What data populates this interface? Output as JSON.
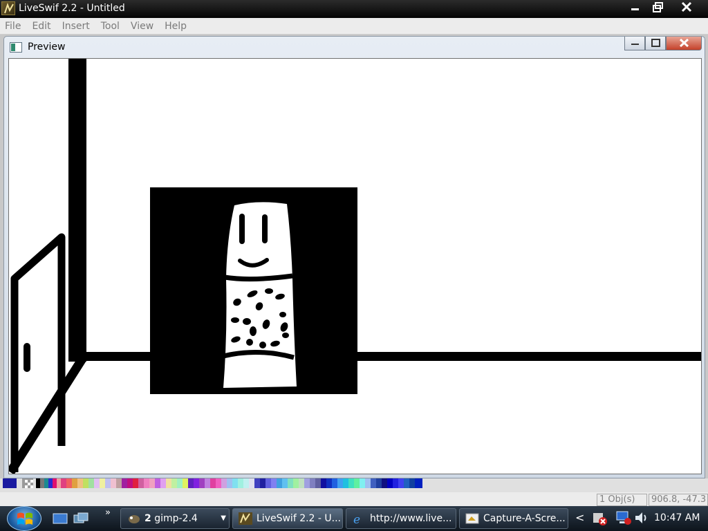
{
  "window": {
    "title": "LiveSwif 2.2 - Untitled"
  },
  "menu": {
    "items": [
      "File",
      "Edit",
      "Insert",
      "Tool",
      "View",
      "Help"
    ]
  },
  "preview": {
    "title": "Preview"
  },
  "status": {
    "objects": "1 Obj(s)",
    "coords": "906.8, -47.3"
  },
  "taskbar": {
    "overflow_glyph": "»",
    "buttons": [
      {
        "label": "2",
        "label2": "gimp-2.4",
        "arrow": "▼"
      },
      {
        "label": "LiveSwif 2.2 - U..."
      },
      {
        "label": "http://www.live..."
      },
      {
        "label": "Capture-A-Scre..."
      }
    ],
    "tray_chevron": "<",
    "clock": "10:47 AM"
  },
  "colors": {
    "titlebar": "#0a0a0a",
    "close_red": "#c4412a",
    "taskbar": "#1a2430"
  }
}
